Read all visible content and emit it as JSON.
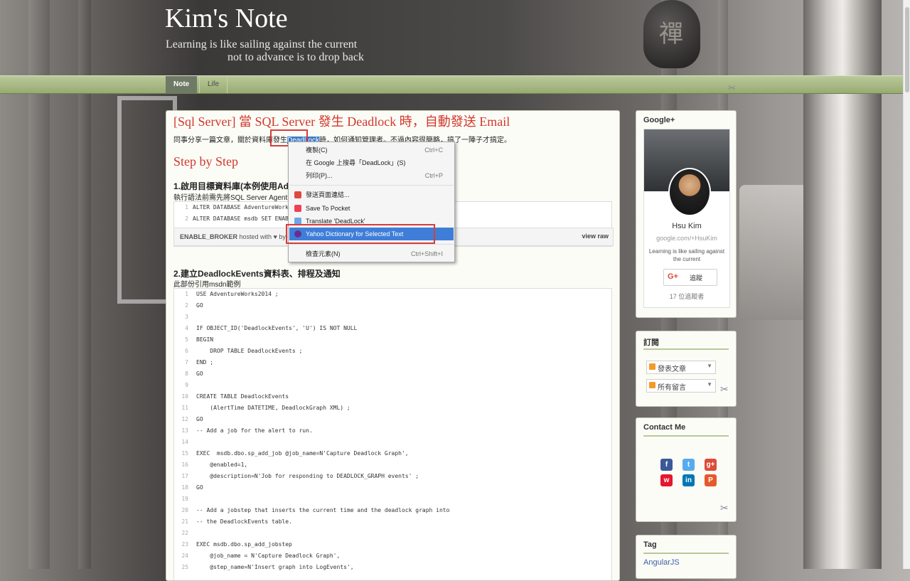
{
  "header": {
    "title": "Kim's Note",
    "tagline_line1": "Learning is like sailing against the current",
    "tagline_line2": "not to advance is to drop back",
    "seal_char": "禪"
  },
  "nav": {
    "tabs": [
      {
        "label": "Note",
        "active": true
      },
      {
        "label": "Life",
        "active": false
      }
    ]
  },
  "post": {
    "title": "[Sql Server] 當 SQL Server 發生 Deadlock 時，自動發送 Email",
    "intro_before": "同事分享一篇文章，關於資料庫發生",
    "intro_highlight": "DeadLock",
    "intro_after": "時，如何通知管理者。不過內容很簡略，搞了一陣子才搞定。",
    "step_heading": "Step by Step",
    "section1_title": "1.啟用目標資料庫(本例使用Adver",
    "section1_sub_before": "執行語法前需先將SQL Server Agent",
    "section1_sub_red": "停用",
    "gist1_lines": [
      {
        "n": "1",
        "code": "ALTER DATABASE AdventureWorks2"
      },
      {
        "n": "2",
        "code": "ALTER DATABASE msdb SET ENABLE"
      }
    ],
    "gist1_meta_name": "ENABLE_BROKER",
    "gist1_meta_by": "hosted with ♥ by Gi",
    "gist1_view_raw": "view raw",
    "section2_title": "2.建立DeadlockEvents資料表、排程及通知",
    "section2_sub": "此部份引用msdn範例",
    "code_lines": [
      {
        "n": "1",
        "code": "USE AdventureWorks2014 ;"
      },
      {
        "n": "2",
        "code": "GO"
      },
      {
        "n": "3",
        "code": ""
      },
      {
        "n": "4",
        "code": "IF OBJECT_ID('DeadlockEvents', 'U') IS NOT NULL"
      },
      {
        "n": "5",
        "code": "BEGIN"
      },
      {
        "n": "6",
        "code": "    DROP TABLE DeadlockEvents ;"
      },
      {
        "n": "7",
        "code": "END ;"
      },
      {
        "n": "8",
        "code": "GO"
      },
      {
        "n": "9",
        "code": ""
      },
      {
        "n": "10",
        "code": "CREATE TABLE DeadlockEvents"
      },
      {
        "n": "11",
        "code": "    (AlertTime DATETIME, DeadlockGraph XML) ;"
      },
      {
        "n": "12",
        "code": "GO"
      },
      {
        "n": "13",
        "code": "-- Add a job for the alert to run."
      },
      {
        "n": "14",
        "code": ""
      },
      {
        "n": "15",
        "code": "EXEC  msdb.dbo.sp_add_job @job_name=N'Capture Deadlock Graph',"
      },
      {
        "n": "16",
        "code": "    @enabled=1,"
      },
      {
        "n": "17",
        "code": "    @description=N'Job for responding to DEADLOCK_GRAPH events' ;"
      },
      {
        "n": "18",
        "code": "GO"
      },
      {
        "n": "19",
        "code": ""
      },
      {
        "n": "20",
        "code": "-- Add a jobstep that inserts the current time and the deadlock graph into"
      },
      {
        "n": "21",
        "code": "-- the DeadlockEvents table."
      },
      {
        "n": "22",
        "code": ""
      },
      {
        "n": "23",
        "code": "EXEC msdb.dbo.sp_add_jobstep"
      },
      {
        "n": "24",
        "code": "    @job_name = N'Capture Deadlock Graph',"
      },
      {
        "n": "25",
        "code": "    @step_name=N'Insert graph into LogEvents',"
      }
    ]
  },
  "context_menu": {
    "items": [
      {
        "label": "複製(C)",
        "shortcut": "Ctrl+C",
        "icon": ""
      },
      {
        "label": "在 Google 上搜尋「DeadLock」(S)",
        "shortcut": "",
        "icon": ""
      },
      {
        "label": "列印(P)...",
        "shortcut": "Ctrl+P",
        "icon": ""
      },
      {
        "label": "發送頁面連結...",
        "shortcut": "",
        "icon": "gmail-icon"
      },
      {
        "label": "Save To Pocket",
        "shortcut": "",
        "icon": "pocket-icon"
      },
      {
        "label": "Translate 'DeadLock'",
        "shortcut": "",
        "icon": "translate-icon"
      },
      {
        "label": "Yahoo Dictionary for Selected Text",
        "shortcut": "",
        "icon": "yahoo-icon"
      },
      {
        "label": "檢查元素(N)",
        "shortcut": "Ctrl+Shift+I",
        "icon": ""
      }
    ]
  },
  "sidebar": {
    "googleplus": {
      "title": "Google+",
      "name": "Hsu Kim",
      "url": "google.com/+HsuKim",
      "tagline": "Learning is like sailing against the current",
      "follow_label": "追蹤",
      "follow_g": "G+",
      "followers": "17 位追蹤者"
    },
    "subscribe": {
      "title": "訂閱",
      "posts": "發表文章",
      "comments": "所有留言"
    },
    "contact": {
      "title": "Contact Me",
      "icons": [
        "facebook-icon",
        "twitter-icon",
        "googleplus-icon",
        "weibo-icon",
        "linkedin-icon",
        "plurk-icon"
      ]
    },
    "tags": {
      "title": "Tag",
      "first": "AngularJS"
    }
  },
  "colors": {
    "accent_red": "#d2372a",
    "nav_green": "#98ab72",
    "menu_selected": "#3f7ed8"
  }
}
